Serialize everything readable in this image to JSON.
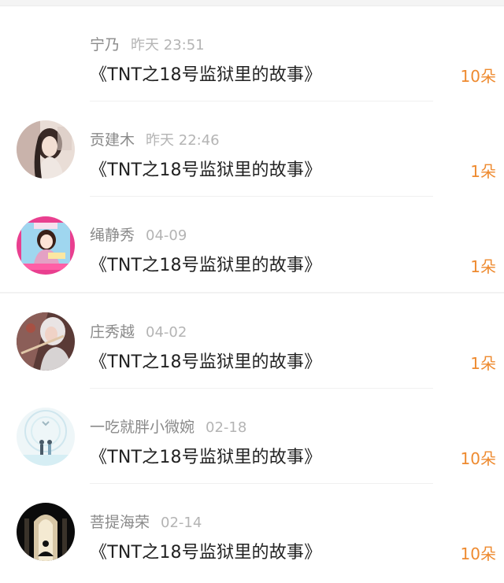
{
  "gifts": [
    {
      "name": "宁乃",
      "time": "昨天 23:51",
      "title": "《TNT之18号监狱里的故事》",
      "amount": "10朵",
      "avatar_icon": "none"
    },
    {
      "name": "贡建木",
      "time": "昨天 22:46",
      "title": "《TNT之18号监狱里的故事》",
      "amount": "1朵",
      "avatar_icon": "woman-portrait-avatar"
    },
    {
      "name": "绳静秀",
      "time": "04-09",
      "title": "《TNT之18号监狱里的故事》",
      "amount": "1朵",
      "avatar_icon": "anime-girl-avatar"
    },
    {
      "name": "庄秀越",
      "time": "04-02",
      "title": "《TNT之18号监狱里的故事》",
      "amount": "1朵",
      "avatar_icon": "swordsman-avatar"
    },
    {
      "name": "一吃就胖小微婉",
      "time": "02-18",
      "title": "《TNT之18号监狱里的故事》",
      "amount": "10朵",
      "avatar_icon": "couple-illustration-avatar"
    },
    {
      "name": "菩提海荣",
      "time": "02-14",
      "title": "《TNT之18号监狱里的故事》",
      "amount": "10朵",
      "avatar_icon": "meditation-silhouette-avatar"
    }
  ],
  "colors": {
    "amount": "#ee8a2f",
    "name": "#8a8a8a",
    "time": "#b4b4b4",
    "title": "#222222"
  }
}
